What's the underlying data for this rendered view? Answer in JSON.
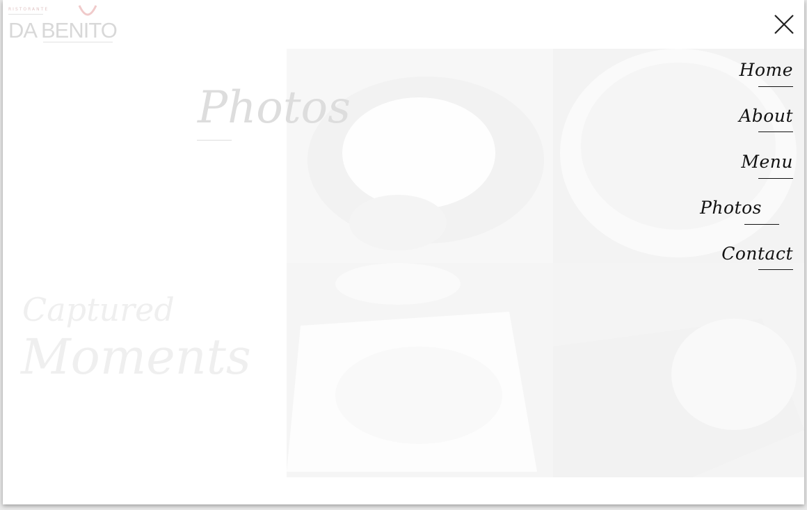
{
  "brand": {
    "subtitle": "RISTORANTE",
    "name": "DA BENITO"
  },
  "hero": {
    "title": "Photos",
    "tagline_1": "Captured",
    "tagline_2": "Moments"
  },
  "nav": {
    "items": [
      {
        "label": "Home"
      },
      {
        "label": "About"
      },
      {
        "label": "Menu"
      },
      {
        "label": "Photos",
        "active": true
      },
      {
        "label": "Contact"
      }
    ]
  },
  "close": {
    "icon": "close-icon"
  },
  "colors": {
    "nav_text": "#111111",
    "logo_accent": "#8a1f1f"
  }
}
